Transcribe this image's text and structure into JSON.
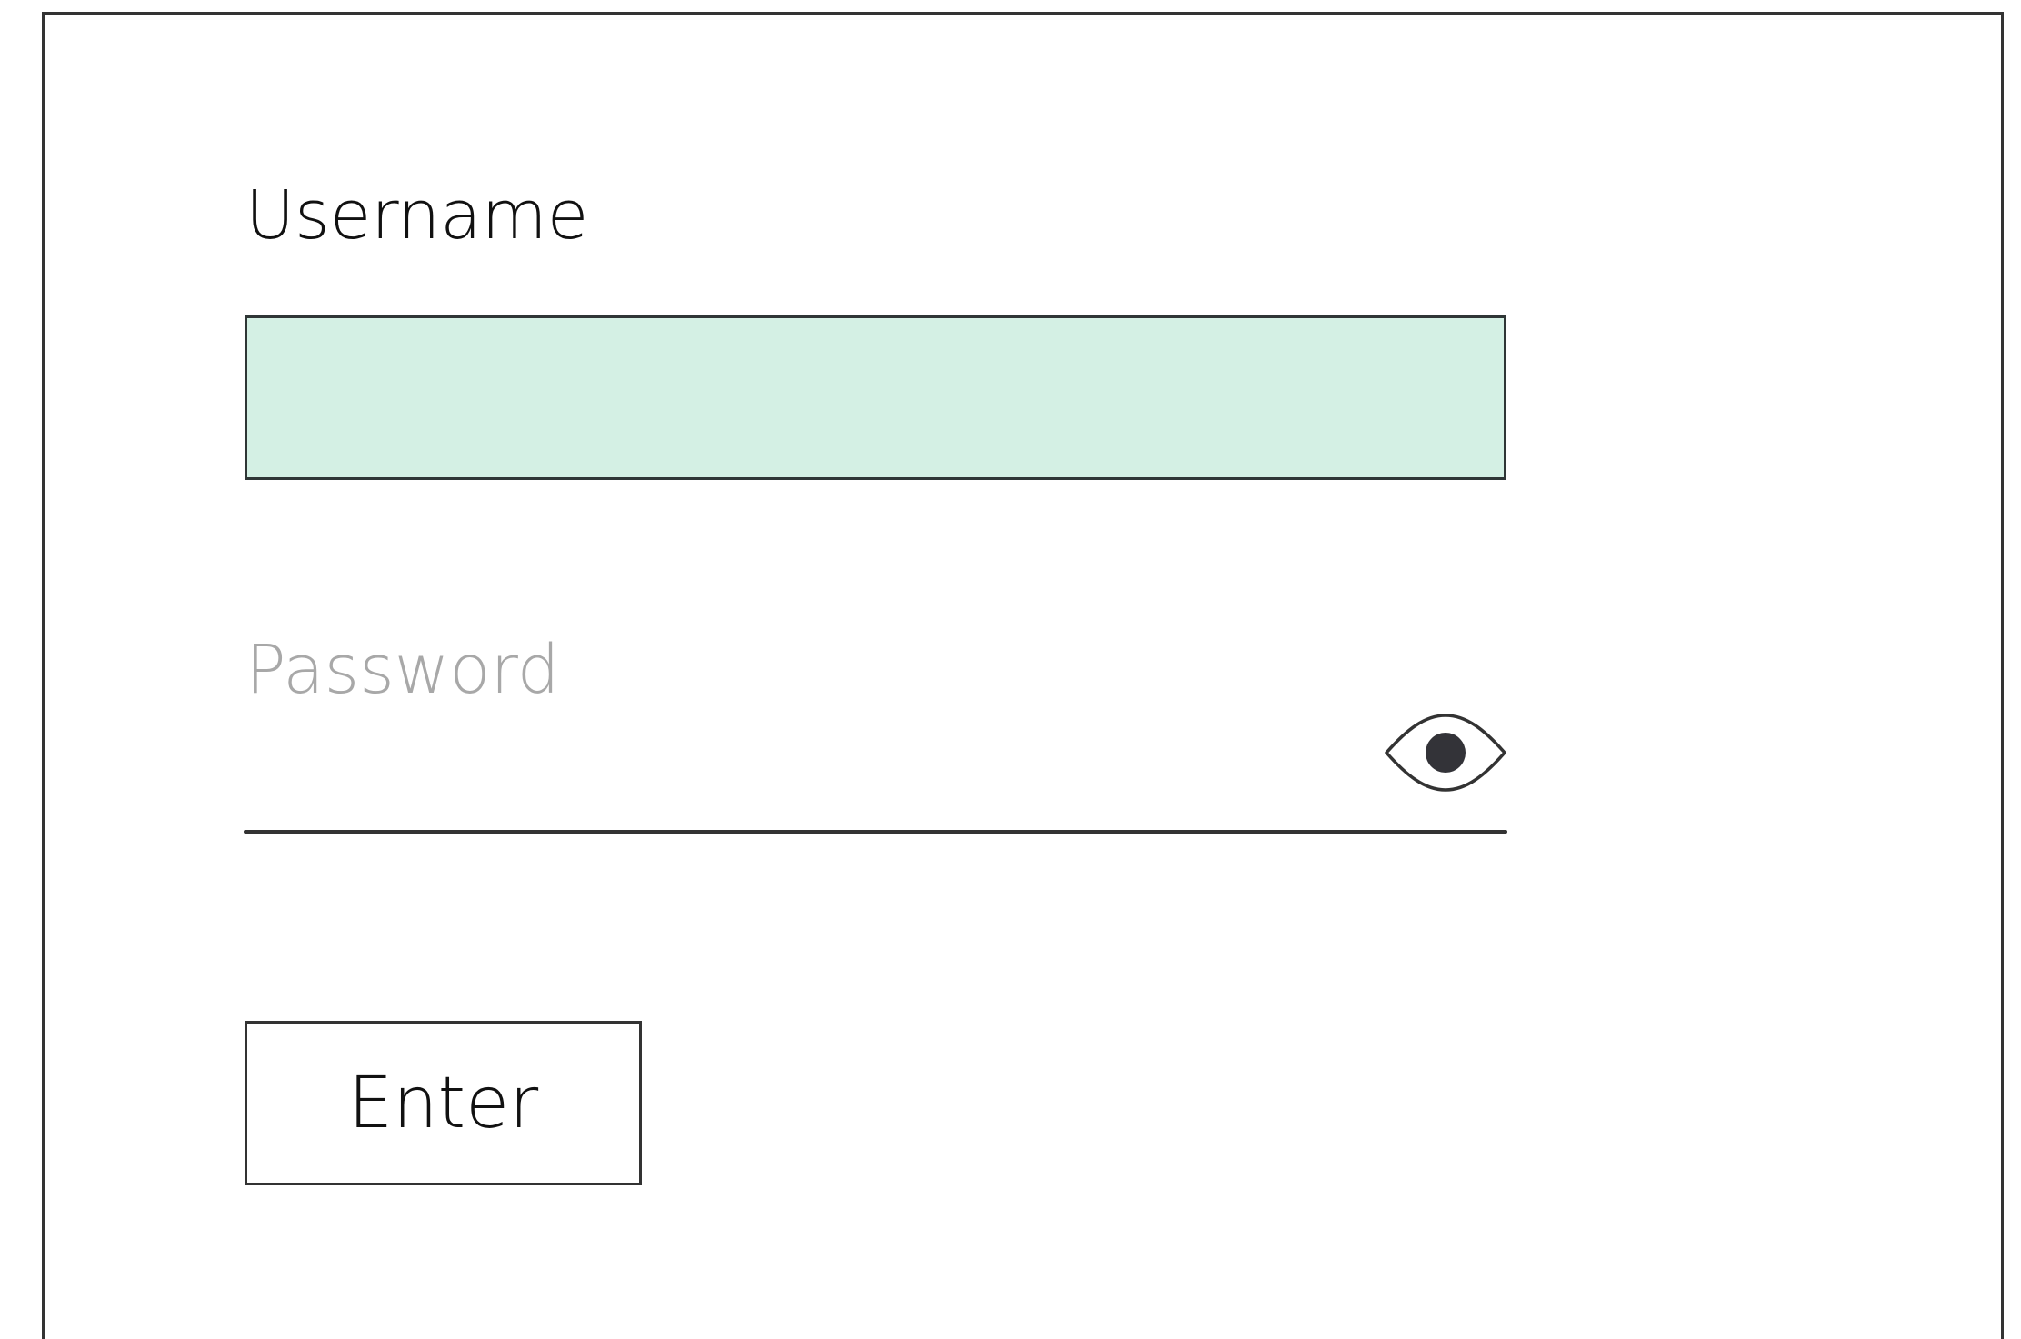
{
  "login_form": {
    "username_label": "Username",
    "username_value": "",
    "password_label": "Password",
    "password_value": "",
    "visibility_icon": "eye-icon",
    "submit_label": "Enter"
  },
  "colors": {
    "username_field_background": "#d4f0e4",
    "border": "#333333",
    "password_label": "#a8a8a8"
  }
}
